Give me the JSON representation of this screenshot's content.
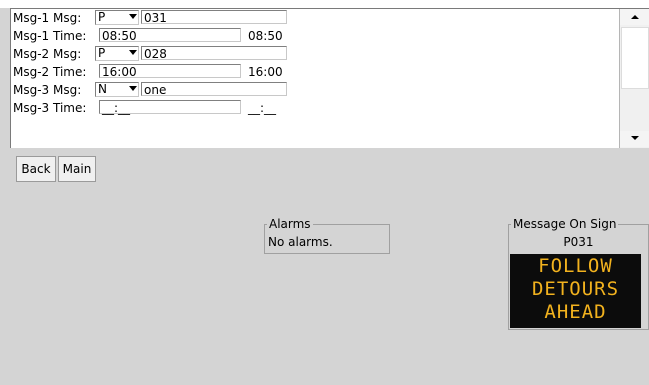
{
  "messages": [
    {
      "msg_label": "Msg-1 Msg:",
      "type": "P",
      "msg_value": "031",
      "time_label": "Msg-1 Time:",
      "time_value": "08:50",
      "time_echo": "08:50"
    },
    {
      "msg_label": "Msg-2 Msg:",
      "type": "P",
      "msg_value": "028",
      "time_label": "Msg-2 Time:",
      "time_value": "16:00",
      "time_echo": "16:00"
    },
    {
      "msg_label": "Msg-3 Msg:",
      "type": "N",
      "msg_value": "one",
      "time_label": "Msg-3 Time:",
      "time_value": "__:__",
      "time_echo": "__:__"
    }
  ],
  "buttons": {
    "back": "Back",
    "main": "Main"
  },
  "alarms": {
    "title": "Alarms",
    "text": "No alarms."
  },
  "sign": {
    "title": "Message On Sign",
    "id": "P031",
    "lines": [
      "FOLLOW",
      "DETOURS",
      "AHEAD"
    ],
    "text_color": "#f2b21e",
    "background": "#0c0c0c"
  }
}
